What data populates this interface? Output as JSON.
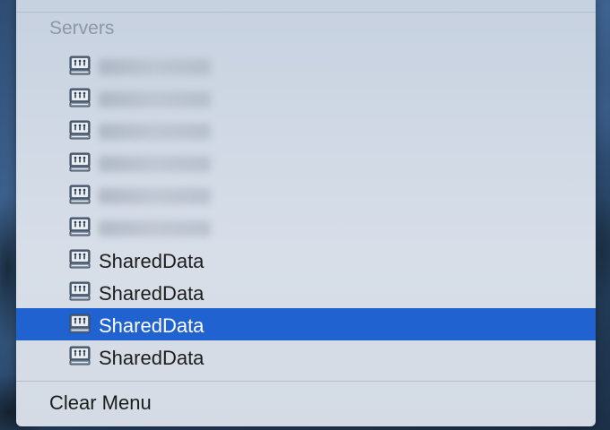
{
  "menu": {
    "section_header": "Servers",
    "servers": [
      {
        "label": "",
        "obscured": true,
        "selected": false
      },
      {
        "label": "",
        "obscured": true,
        "selected": false
      },
      {
        "label": "",
        "obscured": true,
        "selected": false
      },
      {
        "label": "",
        "obscured": true,
        "selected": false
      },
      {
        "label": "",
        "obscured": true,
        "selected": false
      },
      {
        "label": "",
        "obscured": true,
        "selected": false
      },
      {
        "label": "SharedData",
        "obscured": false,
        "selected": false
      },
      {
        "label": "SharedData",
        "obscured": false,
        "selected": false
      },
      {
        "label": "SharedData",
        "obscured": false,
        "selected": true
      },
      {
        "label": "SharedData",
        "obscured": false,
        "selected": false
      }
    ],
    "server_icon": "server-icon",
    "clear_label": "Clear Menu"
  },
  "colors": {
    "selection": "#1f62d0",
    "menu_background": "#d0d8e3",
    "header_text": "#8d97a6"
  }
}
